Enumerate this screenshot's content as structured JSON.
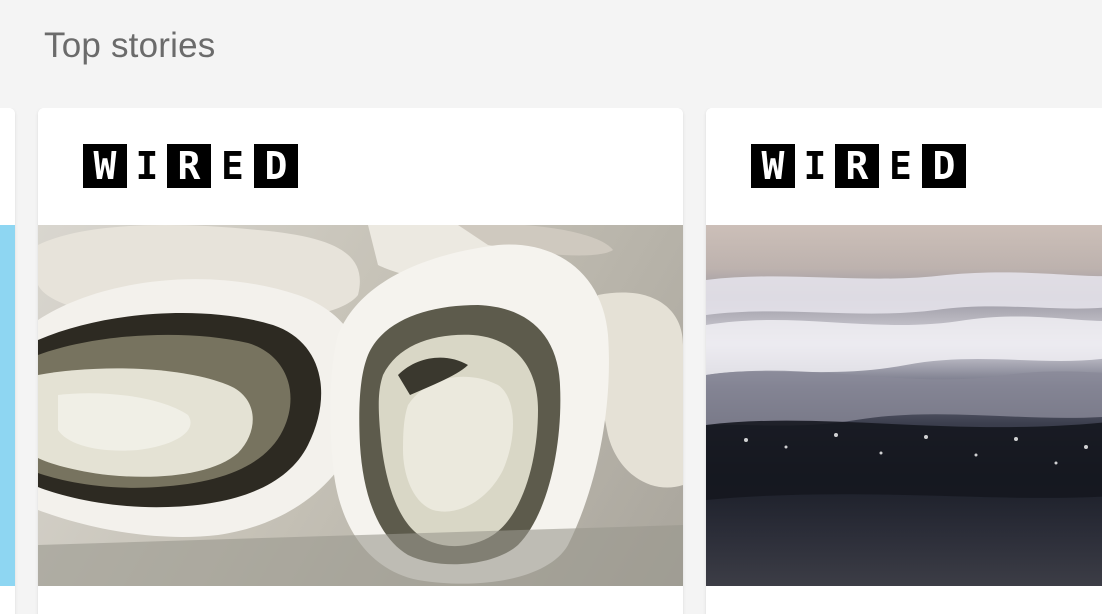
{
  "section": {
    "title": "Top stories"
  },
  "cards": [
    {
      "publisher": "WIRED",
      "image": "oysters-photo"
    },
    {
      "publisher": "WIRED",
      "image": "ocean-waves-photo"
    }
  ],
  "colors": {
    "page_background": "#f4f4f4",
    "card_background": "#ffffff",
    "title_text": "#6b6b6b",
    "prev_card_accent": "#8ed6f2"
  }
}
